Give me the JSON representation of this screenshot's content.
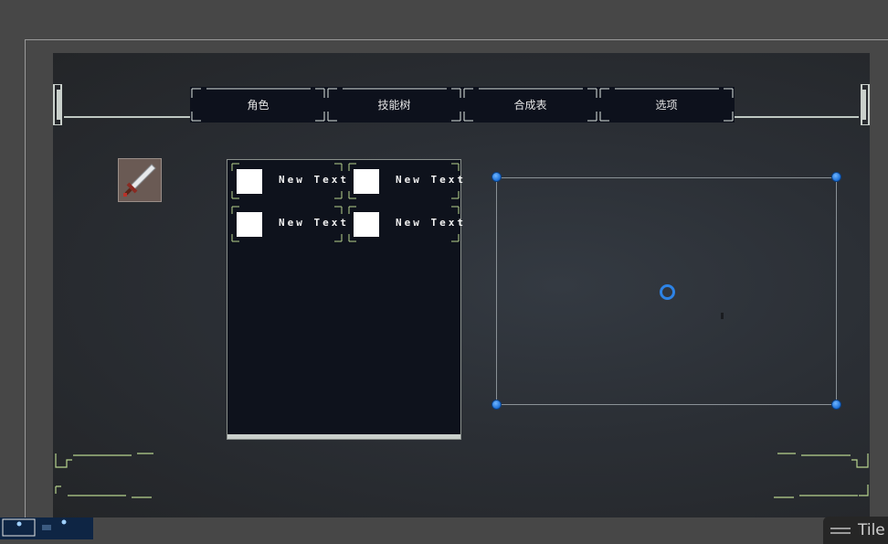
{
  "tabs": [
    {
      "label": "角色"
    },
    {
      "label": "技能树"
    },
    {
      "label": "合成表"
    },
    {
      "label": "选项"
    }
  ],
  "inventory": {
    "slots": [
      {
        "label": "New Text"
      },
      {
        "label": "New Text"
      },
      {
        "label": "New Text"
      },
      {
        "label": "New Text"
      }
    ]
  },
  "icons": {
    "weapon": "sword-icon",
    "pivot": "pivot-circle-icon"
  },
  "footer": {
    "panel_tab_label": "Tile"
  },
  "colors": {
    "panel_dark": "#0e121c",
    "accent_green": "#b8d48e",
    "handle_blue": "#2d83e6"
  }
}
